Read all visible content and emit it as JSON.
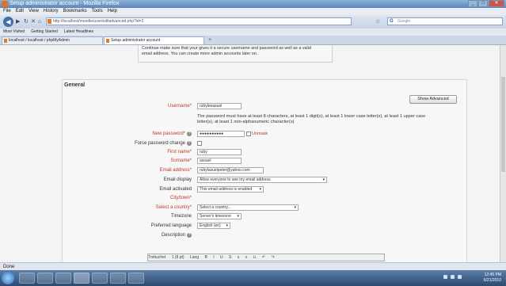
{
  "window": {
    "title": "Setup administrator account - Mozilla Firefox"
  },
  "menubar": [
    "File",
    "Edit",
    "View",
    "History",
    "Bookmarks",
    "Tools",
    "Help"
  ],
  "nav": {
    "url": "http://localhost/moodle/user/editadvanced.php?id=2",
    "search_engine": "G",
    "search_placeholder": "Google"
  },
  "bookmarks": [
    "Most Visited",
    "Getting Started",
    "Latest Headlines"
  ],
  "tabs": [
    {
      "label": "localhost / localhost / phpMyAdmin",
      "active": false
    },
    {
      "label": "Setup administrator account",
      "active": true
    }
  ],
  "info_text": [
    "Continue make sure that your gives it a secure username and password as well as a valid",
    "email address. You can create more admin accounts later on."
  ],
  "section": {
    "legend": "General",
    "show_advanced": "Show Advanced"
  },
  "form": {
    "username": {
      "label": "Username*",
      "value": "rubyleeasuel"
    },
    "password_help": "The password must have at least 8 characters, at least 1 digit(s), at least 1 lower case letter(s), at least 1 upper case letter(s), at least 1 non-alphanumeric character(s)",
    "new_password": {
      "label": "New password*",
      "value": "●●●●●●●●●●",
      "unmask": "Unmask"
    },
    "force_change": {
      "label": "Force password change"
    },
    "first_name": {
      "label": "First name*",
      "value": "ruby"
    },
    "surname": {
      "label": "Surname*",
      "value": "assuel"
    },
    "email": {
      "label": "Email address*",
      "value": "rubylasuelpeter@yahoo.com"
    },
    "email_display": {
      "label": "Email display",
      "value": "Allow everyone to see my email address"
    },
    "email_activated": {
      "label": "Email activated",
      "value": "This email address is enabled"
    },
    "city": {
      "label": "City/town*",
      "value": ""
    },
    "country": {
      "label": "Select a country*",
      "value": "Select a country..."
    },
    "timezone": {
      "label": "Timezone",
      "value": "Server's timezone"
    },
    "language": {
      "label": "Preferred language",
      "value": "English (en)"
    },
    "description": {
      "label": "Description"
    }
  },
  "editor_toolbar": [
    "Trebuchet",
    "1 (8 pt)",
    "Lang",
    "B",
    "I",
    "U",
    "S",
    "x",
    "x",
    "⎌",
    "↶",
    "↷"
  ],
  "status": {
    "text": "Done"
  },
  "tray": {
    "time": "12:45 PM",
    "date": "6/21/2010"
  }
}
